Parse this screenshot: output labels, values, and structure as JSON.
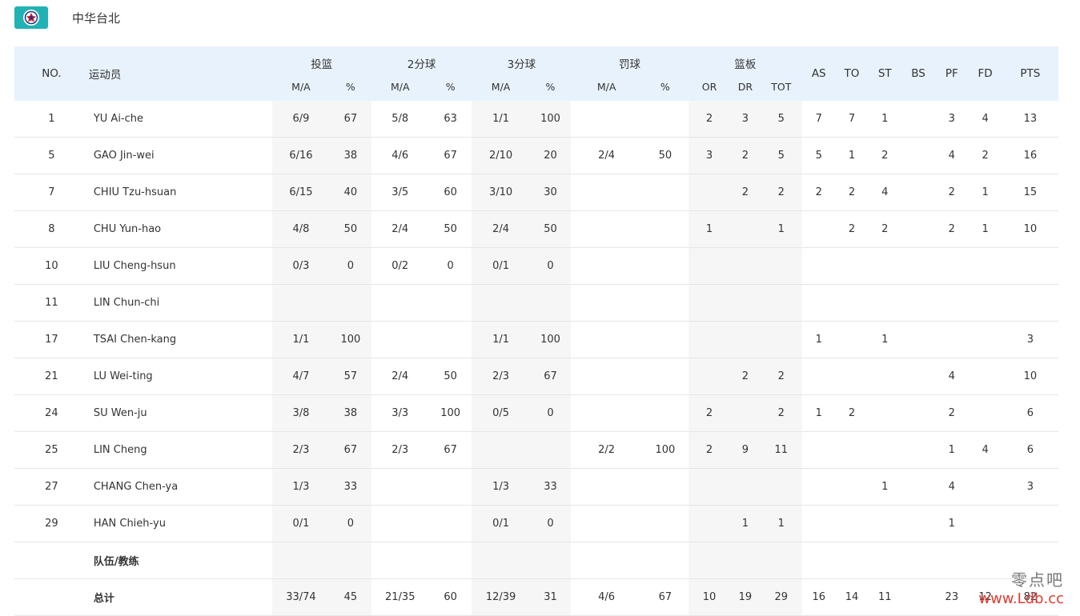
{
  "team": {
    "name": "中华台北",
    "flag_icon": "chinese-taipei-flag-icon",
    "flag_color": "#20b2b5"
  },
  "headers": {
    "no": "NO.",
    "player": "运动员",
    "fg": "投篮",
    "two": "2分球",
    "three": "3分球",
    "ft": "罚球",
    "reb": "篮板",
    "ma": "M/A",
    "pct": "%",
    "or": "OR",
    "dr": "DR",
    "tot": "TOT",
    "as": "AS",
    "to": "TO",
    "st": "ST",
    "bs": "BS",
    "pf": "PF",
    "fd": "FD",
    "pts": "PTS"
  },
  "rows": [
    {
      "no": "1",
      "name": "YU Ai-che",
      "fg_ma": "6/9",
      "fg_pct": "67",
      "two_ma": "5/8",
      "two_pct": "63",
      "three_ma": "1/1",
      "three_pct": "100",
      "ft_ma": "",
      "ft_pct": "",
      "or": "2",
      "dr": "3",
      "tot": "5",
      "as": "7",
      "to": "7",
      "st": "1",
      "bs": "",
      "pf": "3",
      "fd": "4",
      "pts": "13"
    },
    {
      "no": "5",
      "name": "GAO Jin-wei",
      "fg_ma": "6/16",
      "fg_pct": "38",
      "two_ma": "4/6",
      "two_pct": "67",
      "three_ma": "2/10",
      "three_pct": "20",
      "ft_ma": "2/4",
      "ft_pct": "50",
      "or": "3",
      "dr": "2",
      "tot": "5",
      "as": "5",
      "to": "1",
      "st": "2",
      "bs": "",
      "pf": "4",
      "fd": "2",
      "pts": "16"
    },
    {
      "no": "7",
      "name": "CHIU Tzu-hsuan",
      "fg_ma": "6/15",
      "fg_pct": "40",
      "two_ma": "3/5",
      "two_pct": "60",
      "three_ma": "3/10",
      "three_pct": "30",
      "ft_ma": "",
      "ft_pct": "",
      "or": "",
      "dr": "2",
      "tot": "2",
      "as": "2",
      "to": "2",
      "st": "4",
      "bs": "",
      "pf": "2",
      "fd": "1",
      "pts": "15"
    },
    {
      "no": "8",
      "name": "CHU Yun-hao",
      "fg_ma": "4/8",
      "fg_pct": "50",
      "two_ma": "2/4",
      "two_pct": "50",
      "three_ma": "2/4",
      "three_pct": "50",
      "ft_ma": "",
      "ft_pct": "",
      "or": "1",
      "dr": "",
      "tot": "1",
      "as": "",
      "to": "2",
      "st": "2",
      "bs": "",
      "pf": "2",
      "fd": "1",
      "pts": "10"
    },
    {
      "no": "10",
      "name": "LIU Cheng-hsun",
      "fg_ma": "0/3",
      "fg_pct": "0",
      "two_ma": "0/2",
      "two_pct": "0",
      "three_ma": "0/1",
      "three_pct": "0",
      "ft_ma": "",
      "ft_pct": "",
      "or": "",
      "dr": "",
      "tot": "",
      "as": "",
      "to": "",
      "st": "",
      "bs": "",
      "pf": "",
      "fd": "",
      "pts": ""
    },
    {
      "no": "11",
      "name": "LIN Chun-chi",
      "fg_ma": "",
      "fg_pct": "",
      "two_ma": "",
      "two_pct": "",
      "three_ma": "",
      "three_pct": "",
      "ft_ma": "",
      "ft_pct": "",
      "or": "",
      "dr": "",
      "tot": "",
      "as": "",
      "to": "",
      "st": "",
      "bs": "",
      "pf": "",
      "fd": "",
      "pts": ""
    },
    {
      "no": "17",
      "name": "TSAI Chen-kang",
      "fg_ma": "1/1",
      "fg_pct": "100",
      "two_ma": "",
      "two_pct": "",
      "three_ma": "1/1",
      "three_pct": "100",
      "ft_ma": "",
      "ft_pct": "",
      "or": "",
      "dr": "",
      "tot": "",
      "as": "1",
      "to": "",
      "st": "1",
      "bs": "",
      "pf": "",
      "fd": "",
      "pts": "3"
    },
    {
      "no": "21",
      "name": "LU Wei-ting",
      "fg_ma": "4/7",
      "fg_pct": "57",
      "two_ma": "2/4",
      "two_pct": "50",
      "three_ma": "2/3",
      "three_pct": "67",
      "ft_ma": "",
      "ft_pct": "",
      "or": "",
      "dr": "2",
      "tot": "2",
      "as": "",
      "to": "",
      "st": "",
      "bs": "",
      "pf": "4",
      "fd": "",
      "pts": "10"
    },
    {
      "no": "24",
      "name": "SU Wen-ju",
      "fg_ma": "3/8",
      "fg_pct": "38",
      "two_ma": "3/3",
      "two_pct": "100",
      "three_ma": "0/5",
      "three_pct": "0",
      "ft_ma": "",
      "ft_pct": "",
      "or": "2",
      "dr": "",
      "tot": "2",
      "as": "1",
      "to": "2",
      "st": "",
      "bs": "",
      "pf": "2",
      "fd": "",
      "pts": "6"
    },
    {
      "no": "25",
      "name": "LIN Cheng",
      "fg_ma": "2/3",
      "fg_pct": "67",
      "two_ma": "2/3",
      "two_pct": "67",
      "three_ma": "",
      "three_pct": "",
      "ft_ma": "2/2",
      "ft_pct": "100",
      "or": "2",
      "dr": "9",
      "tot": "11",
      "as": "",
      "to": "",
      "st": "",
      "bs": "",
      "pf": "1",
      "fd": "4",
      "pts": "6"
    },
    {
      "no": "27",
      "name": "CHANG Chen-ya",
      "fg_ma": "1/3",
      "fg_pct": "33",
      "two_ma": "",
      "two_pct": "",
      "three_ma": "1/3",
      "three_pct": "33",
      "ft_ma": "",
      "ft_pct": "",
      "or": "",
      "dr": "",
      "tot": "",
      "as": "",
      "to": "",
      "st": "1",
      "bs": "",
      "pf": "4",
      "fd": "",
      "pts": "3"
    },
    {
      "no": "29",
      "name": "HAN Chieh-yu",
      "fg_ma": "0/1",
      "fg_pct": "0",
      "two_ma": "",
      "two_pct": "",
      "three_ma": "0/1",
      "three_pct": "0",
      "ft_ma": "",
      "ft_pct": "",
      "or": "",
      "dr": "1",
      "tot": "1",
      "as": "",
      "to": "",
      "st": "",
      "bs": "",
      "pf": "1",
      "fd": "",
      "pts": ""
    },
    {
      "no": "",
      "name": "队伍/教练",
      "bold": true,
      "fg_ma": "",
      "fg_pct": "",
      "two_ma": "",
      "two_pct": "",
      "three_ma": "",
      "three_pct": "",
      "ft_ma": "",
      "ft_pct": "",
      "or": "",
      "dr": "",
      "tot": "",
      "as": "",
      "to": "",
      "st": "",
      "bs": "",
      "pf": "",
      "fd": "",
      "pts": ""
    },
    {
      "no": "",
      "name": "总计",
      "bold": true,
      "fg_ma": "33/74",
      "fg_pct": "45",
      "two_ma": "21/35",
      "two_pct": "60",
      "three_ma": "12/39",
      "three_pct": "31",
      "ft_ma": "4/6",
      "ft_pct": "67",
      "or": "10",
      "dr": "19",
      "tot": "29",
      "as": "16",
      "to": "14",
      "st": "11",
      "bs": "",
      "pf": "23",
      "fd": "12",
      "pts": "82"
    }
  ],
  "watermark": {
    "line1": "零点吧",
    "line2": "www.Ldb.cc"
  }
}
